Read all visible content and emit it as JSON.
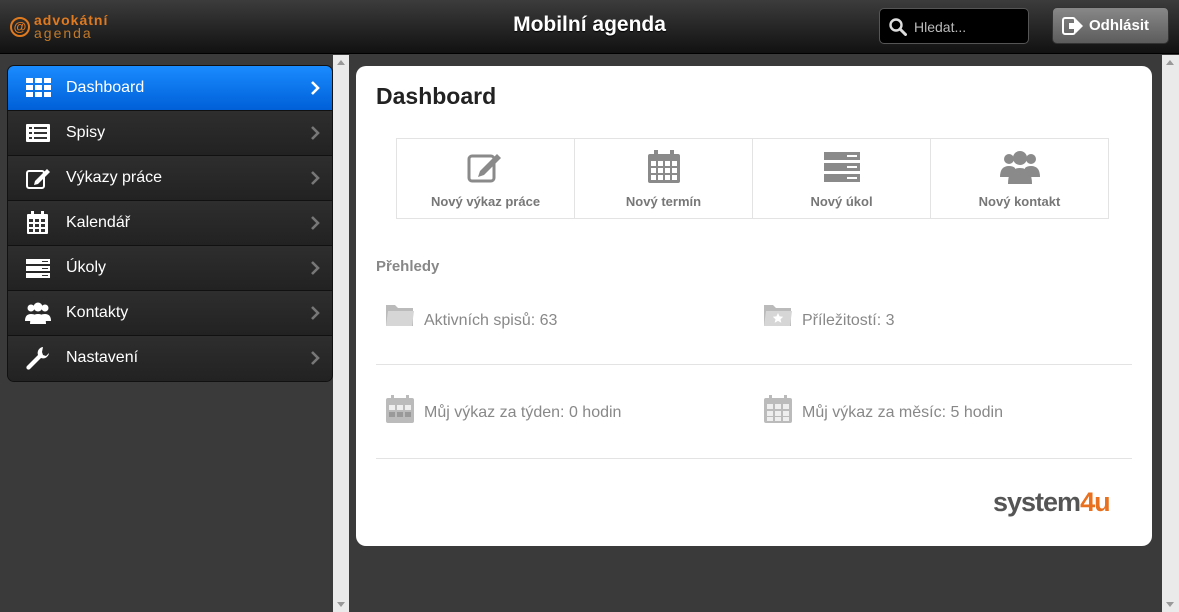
{
  "header": {
    "logo_line1": "advokátní",
    "logo_line2": "agenda",
    "title": "Mobilní agenda",
    "search_placeholder": "Hledat...",
    "logout_label": "Odhlásit"
  },
  "sidebar": {
    "items": [
      {
        "label": "Dashboard",
        "icon": "grid-icon",
        "active": true
      },
      {
        "label": "Spisy",
        "icon": "list-icon"
      },
      {
        "label": "Výkazy práce",
        "icon": "edit-icon"
      },
      {
        "label": "Kalendář",
        "icon": "calendar-icon"
      },
      {
        "label": "Úkoly",
        "icon": "tasks-icon"
      },
      {
        "label": "Kontakty",
        "icon": "users-icon"
      },
      {
        "label": "Nastavení",
        "icon": "wrench-icon"
      }
    ]
  },
  "main": {
    "title": "Dashboard",
    "actions": [
      {
        "label": "Nový výkaz práce",
        "icon": "edit-icon"
      },
      {
        "label": "Nový termín",
        "icon": "calendar-icon"
      },
      {
        "label": "Nový úkol",
        "icon": "tasks-icon"
      },
      {
        "label": "Nový kontakt",
        "icon": "users-icon"
      }
    ],
    "overview_title": "Přehledy",
    "stats": [
      {
        "label": "Aktivních spisů: 63",
        "icon": "folder-icon"
      },
      {
        "label": "Příležitostí: 3",
        "icon": "star-folder-icon"
      },
      {
        "label": "Můj výkaz za týden: 0 hodin",
        "icon": "calendar-week-icon"
      },
      {
        "label": "Můj výkaz za měsíc: 5 hodin",
        "icon": "calendar-month-icon"
      }
    ],
    "brand_main": "system",
    "brand_accent": "4u"
  },
  "colors": {
    "accent": "#0a7ff0",
    "brand_orange": "#e8701e",
    "header_bg": "#1a1a1a"
  }
}
